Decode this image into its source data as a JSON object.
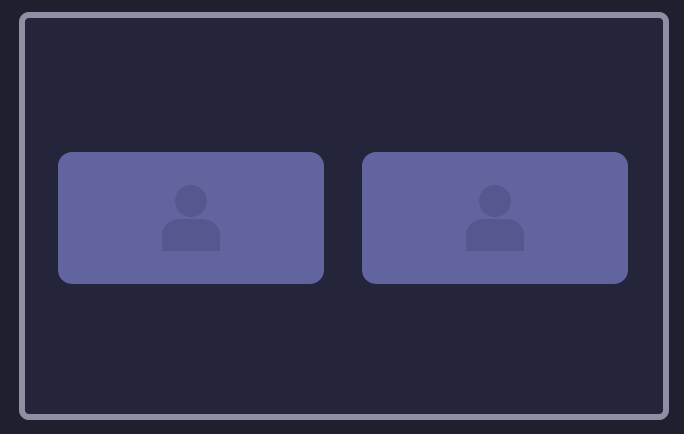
{
  "window": {
    "frame_color": "#8e8ea4",
    "background_color": "#24243b"
  },
  "participants": [
    {
      "tile_color": "#6264a0",
      "icon": "person-icon",
      "icon_color": "#56578e"
    },
    {
      "tile_color": "#6264a0",
      "icon": "person-icon",
      "icon_color": "#56578e"
    }
  ]
}
